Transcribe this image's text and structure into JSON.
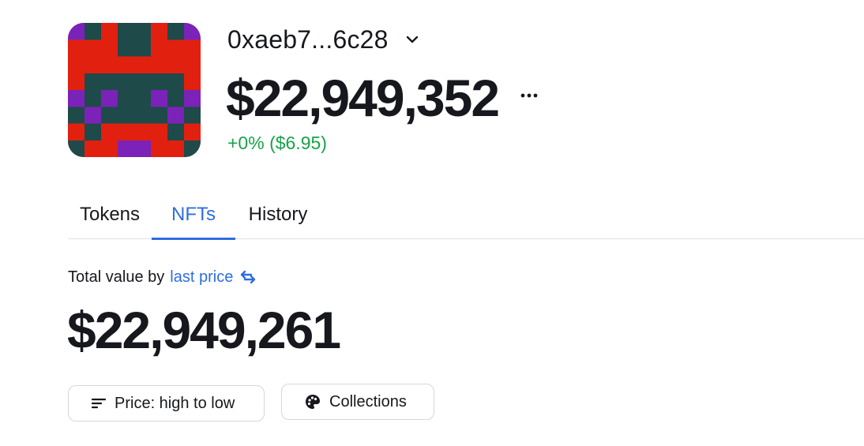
{
  "header": {
    "account_name": "0xaeb7...6c28",
    "balance": "$22,949,352",
    "change": "+0% ($6.95)"
  },
  "tabs": [
    {
      "label": "Tokens",
      "active": false
    },
    {
      "label": "NFTs",
      "active": true
    },
    {
      "label": "History",
      "active": false
    }
  ],
  "summary": {
    "label": "Total value by",
    "mode": "last price",
    "total": "$22,949,261"
  },
  "filters": {
    "sort_label": "Price: high to low",
    "collections_label": "Collections"
  },
  "icons": {
    "account_menu": "chevron-down-icon",
    "more": "ellipsis-icon",
    "swap": "swap-arrows-icon",
    "sort": "sort-lines-icon",
    "collections": "palette-icon"
  },
  "colors": {
    "accent": "#2e6ee0",
    "positive": "#16a34a",
    "text": "#16181d",
    "border": "#d4d7dc",
    "avatar_red": "#e2200f",
    "avatar_teal": "#1e4a4a",
    "avatar_purple": "#7b22b8"
  }
}
